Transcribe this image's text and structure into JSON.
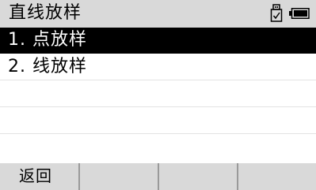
{
  "header": {
    "title": "直线放样",
    "icons": [
      "usb-icon",
      "battery-icon"
    ]
  },
  "menu": {
    "selected_index": 0,
    "items": [
      {
        "label": "1. 点放样"
      },
      {
        "label": "2. 线放样"
      }
    ]
  },
  "softkeys": [
    {
      "label": "返回"
    },
    {
      "label": ""
    },
    {
      "label": ""
    },
    {
      "label": ""
    }
  ]
}
